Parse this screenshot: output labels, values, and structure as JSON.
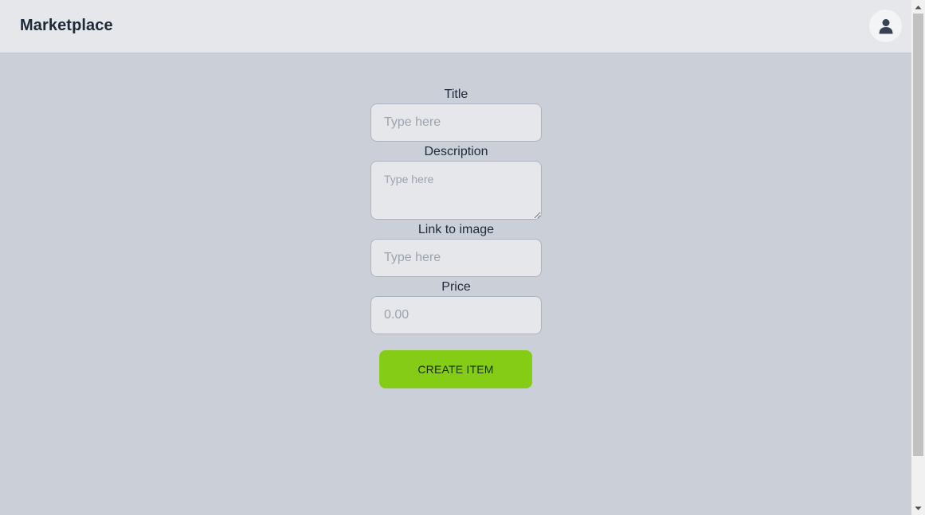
{
  "navbar": {
    "brand": "Marketplace",
    "avatar_icon": "user-icon"
  },
  "form": {
    "title": {
      "label": "Title",
      "placeholder": "Type here",
      "value": ""
    },
    "description": {
      "label": "Description",
      "placeholder": "Type here",
      "value": ""
    },
    "image_link": {
      "label": "Link to image",
      "placeholder": "Type here",
      "value": ""
    },
    "price": {
      "label": "Price",
      "placeholder": "0.00",
      "value": ""
    },
    "submit_label": "CREATE ITEM"
  },
  "colors": {
    "page_background": "#cbd0d8",
    "navbar_background": "#e5e7eb",
    "accent": "#84cc16",
    "text": "#1f2937"
  }
}
